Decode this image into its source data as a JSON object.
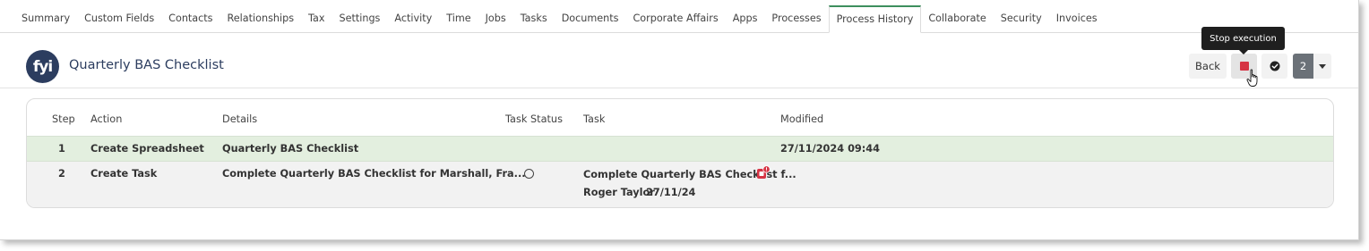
{
  "tabs": [
    {
      "label": "Summary",
      "active": false
    },
    {
      "label": "Custom Fields",
      "active": false
    },
    {
      "label": "Contacts",
      "active": false
    },
    {
      "label": "Relationships",
      "active": false
    },
    {
      "label": "Tax",
      "active": false
    },
    {
      "label": "Settings",
      "active": false
    },
    {
      "label": "Activity",
      "active": false
    },
    {
      "label": "Time",
      "active": false
    },
    {
      "label": "Jobs",
      "active": false
    },
    {
      "label": "Tasks",
      "active": false
    },
    {
      "label": "Documents",
      "active": false
    },
    {
      "label": "Corporate Affairs",
      "active": false
    },
    {
      "label": "Apps",
      "active": false
    },
    {
      "label": "Processes",
      "active": false
    },
    {
      "label": "Process History",
      "active": true
    },
    {
      "label": "Collaborate",
      "active": false
    },
    {
      "label": "Security",
      "active": false
    },
    {
      "label": "Invoices",
      "active": false
    }
  ],
  "header": {
    "logo_text": "fyi",
    "title": "Quarterly BAS Checklist",
    "back_label": "Back",
    "count_label": "2",
    "tooltip": "Stop execution",
    "icons": [
      "stop-icon",
      "check-circle-icon",
      "caret-down-icon"
    ]
  },
  "table": {
    "headers": {
      "step": "Step",
      "action": "Action",
      "details": "Details",
      "task_status": "Task Status",
      "task": "Task",
      "modified": "Modified"
    },
    "rows": [
      {
        "step": "1",
        "action": "Create Spreadsheet",
        "details": "Quarterly BAS Checklist",
        "task_status": "",
        "task": "",
        "task_assignee": "",
        "task_date": "",
        "modified": "27/11/2024 09:44",
        "highlight": true
      },
      {
        "step": "2",
        "action": "Create Task",
        "details": "Complete Quarterly BAS Checklist for Marshall, Fra...",
        "task_status": "open-circle-icon",
        "task": "Complete Quarterly BAS Checklist f...",
        "task_assignee": "Roger Taylor",
        "task_date": "27/11/24",
        "modified": "",
        "highlight": false
      }
    ]
  },
  "colors": {
    "active_tab_border": "#3d8f5e",
    "logo_bg": "#2c3d5f",
    "stop_red": "#d63444",
    "row_highlight": "#e3efdf"
  }
}
